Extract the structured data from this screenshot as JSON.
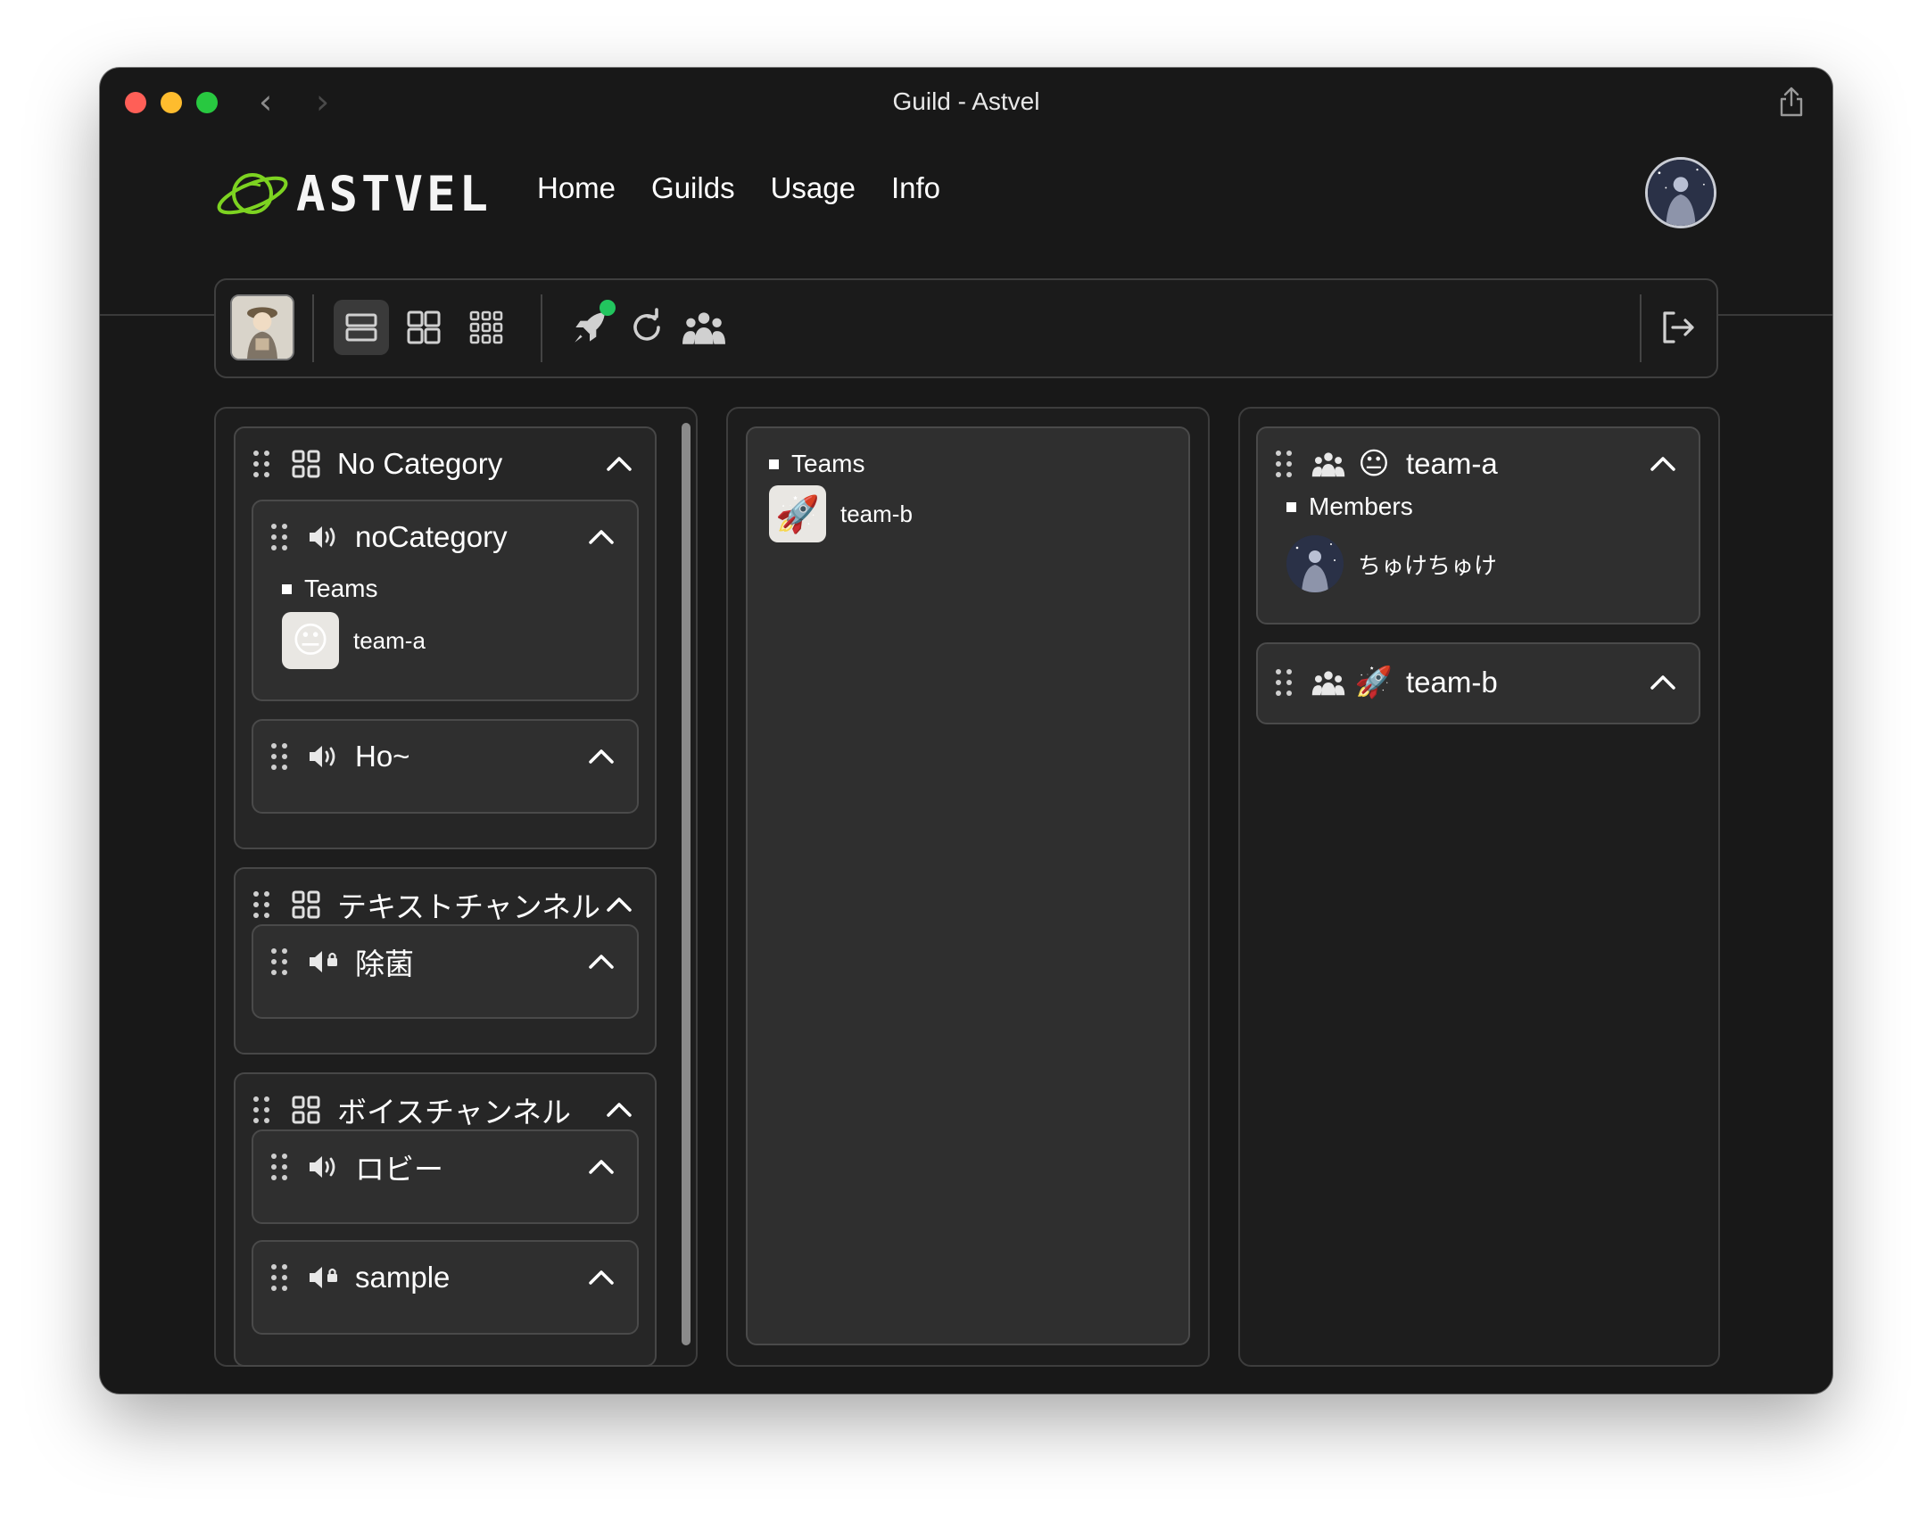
{
  "window": {
    "title": "Guild - Astvel"
  },
  "header": {
    "logo_text": "ASTVEL",
    "nav": [
      {
        "label": "Home"
      },
      {
        "label": "Guilds"
      },
      {
        "label": "Usage"
      },
      {
        "label": "Info"
      }
    ]
  },
  "toolbar": {
    "layout_modes": [
      "list-layout-icon",
      "grid-2-icon",
      "grid-3-icon"
    ],
    "active_layout": "list-layout-icon",
    "bot_status_color": "#22c55e"
  },
  "channels_panel": {
    "categories": [
      {
        "name": "No Category",
        "channels": [
          {
            "name": "noCategory",
            "icon": "speaker-icon",
            "teams_label": "Teams",
            "teams": [
              {
                "name": "team-a",
                "emoji": "😐"
              }
            ]
          },
          {
            "name": "Ho~",
            "icon": "speaker-icon"
          }
        ]
      },
      {
        "name": "テキストチャンネル",
        "channels": [
          {
            "name": "除菌",
            "icon": "speaker-lock-icon"
          }
        ]
      },
      {
        "name": "ボイスチャンネル",
        "channels": [
          {
            "name": "ロビー",
            "icon": "speaker-icon"
          },
          {
            "name": "sample",
            "icon": "speaker-lock-icon"
          }
        ]
      }
    ]
  },
  "unassigned_panel": {
    "label": "Teams",
    "teams": [
      {
        "name": "team-b",
        "emoji": "🚀"
      }
    ]
  },
  "teams_panel": {
    "teams": [
      {
        "name": "team-a",
        "emoji": "😐",
        "members_label": "Members",
        "members": [
          {
            "name": "ちゅけちゅけ"
          }
        ]
      },
      {
        "name": "team-b",
        "emoji": "🚀"
      }
    ]
  }
}
